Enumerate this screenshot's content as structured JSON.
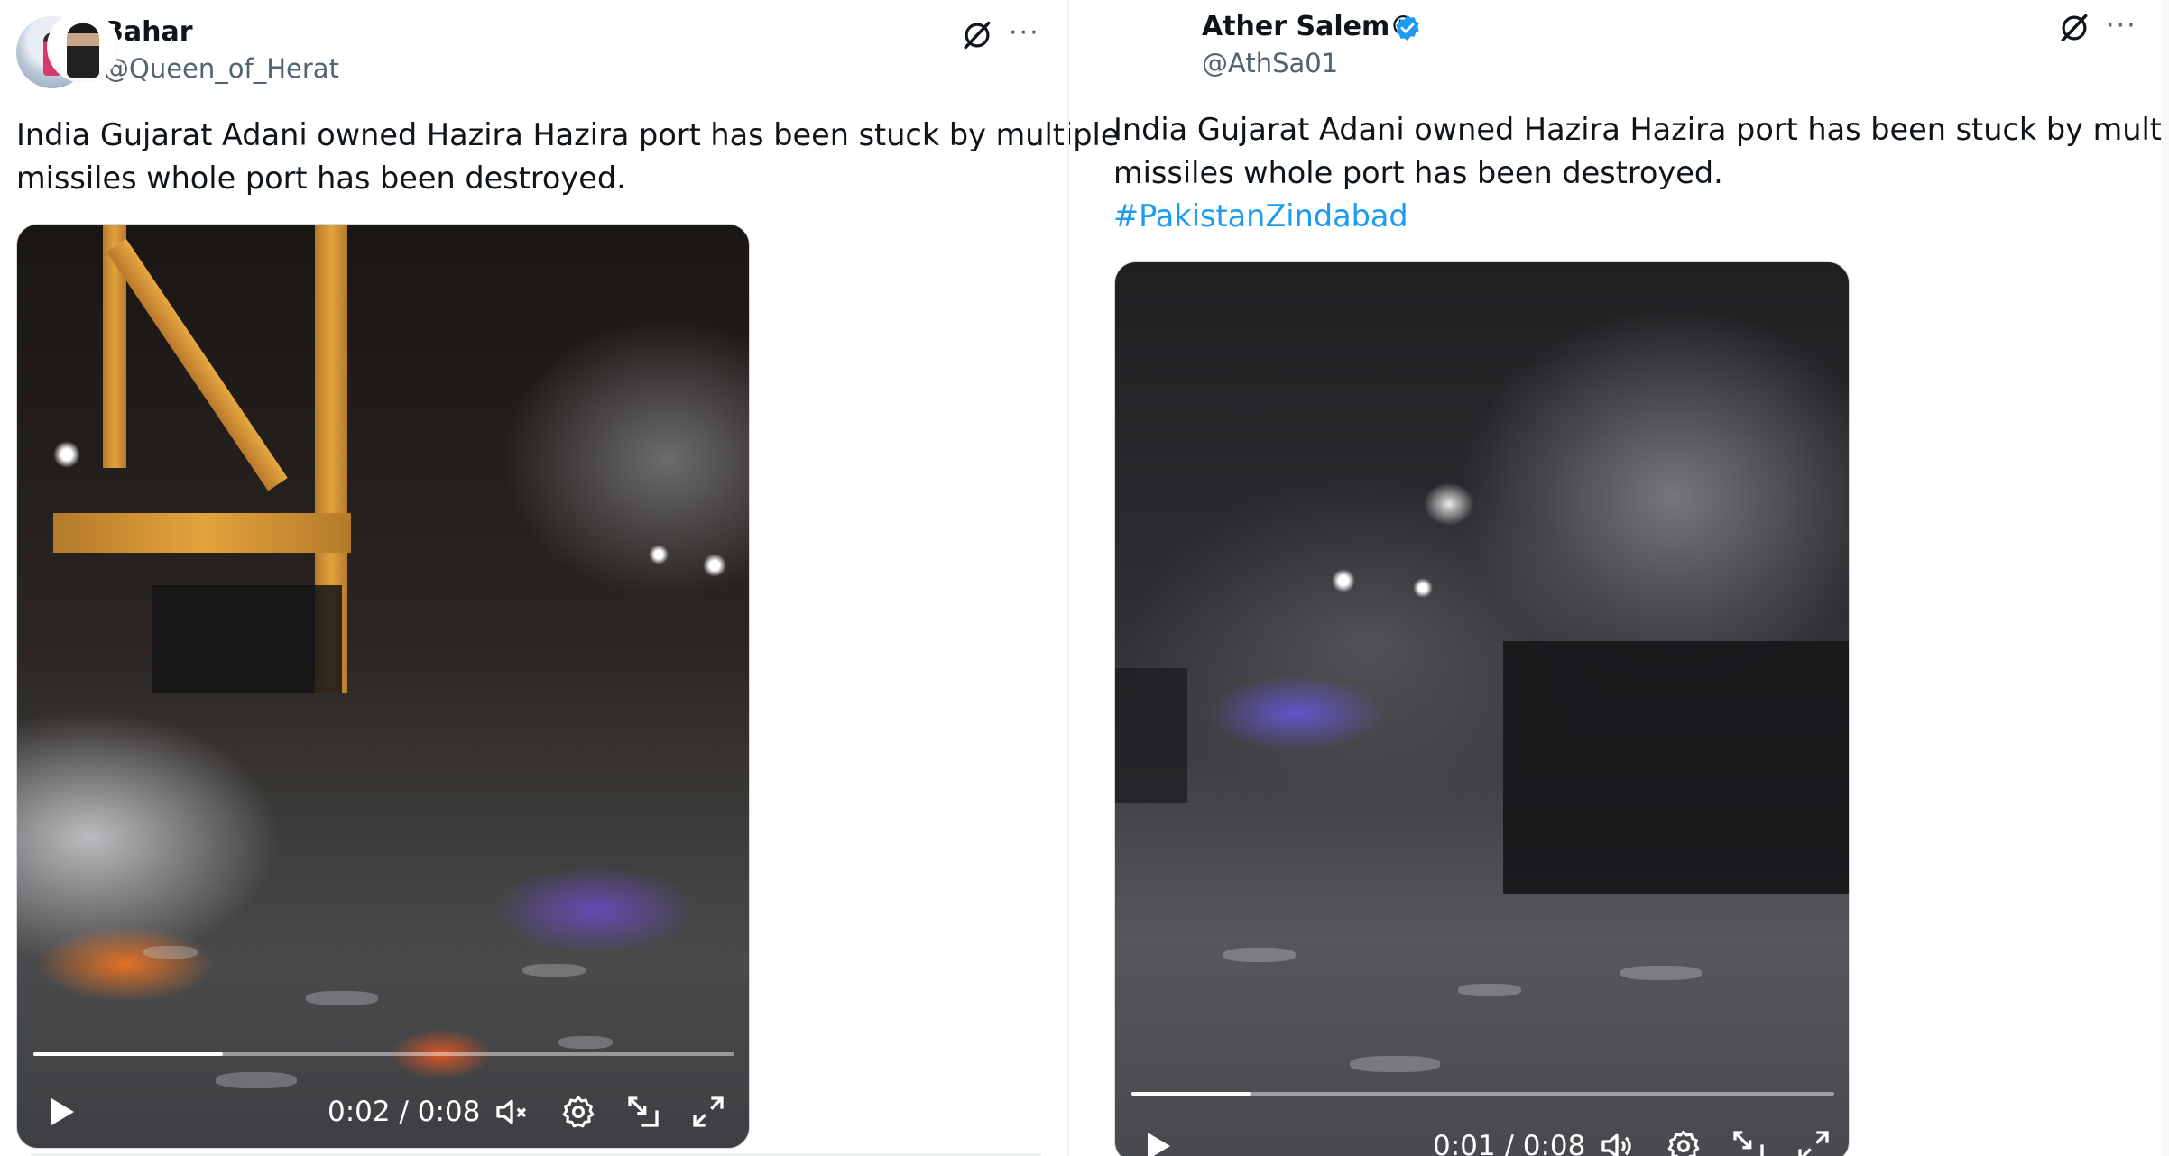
{
  "tweets": [
    {
      "display_name": "Bahar",
      "handle": "@Queen_of_Herat",
      "verified": false,
      "text_lines": [
        "India Gujarat Adani owned Hazira Hazira port has been stuck by multiple",
        "missiles whole port has been destroyed."
      ],
      "hashtag": "",
      "video": {
        "time_label": "0:02 / 0:08",
        "progress": 0.27,
        "sound": "muted"
      },
      "icons": {
        "header": [
          "grok-icon",
          "more-icon"
        ],
        "controls": [
          "play-icon",
          "mute-icon",
          "settings-icon",
          "dock-icon",
          "fullscreen-icon"
        ]
      }
    },
    {
      "display_name": "Ather Salem®",
      "handle": "@AthSa01",
      "verified": true,
      "text_lines": [
        "India Gujarat Adani owned Hazira Hazira port has been stuck by multiple",
        "missiles whole port has been destroyed."
      ],
      "hashtag": "#PakistanZindabad",
      "video": {
        "time_label": "0:01 / 0:08",
        "progress": 0.17,
        "sound": "on"
      },
      "icons": {
        "header": [
          "grok-icon",
          "more-icon"
        ],
        "controls": [
          "play-icon",
          "volume-icon",
          "settings-icon",
          "dock-icon",
          "fullscreen-icon"
        ]
      }
    }
  ],
  "colors": {
    "handle": "#536471",
    "hashtag": "#1d9bf0",
    "verified_badge": "#1d9bf0",
    "text": "#0f1419"
  },
  "more_glyph": "···"
}
